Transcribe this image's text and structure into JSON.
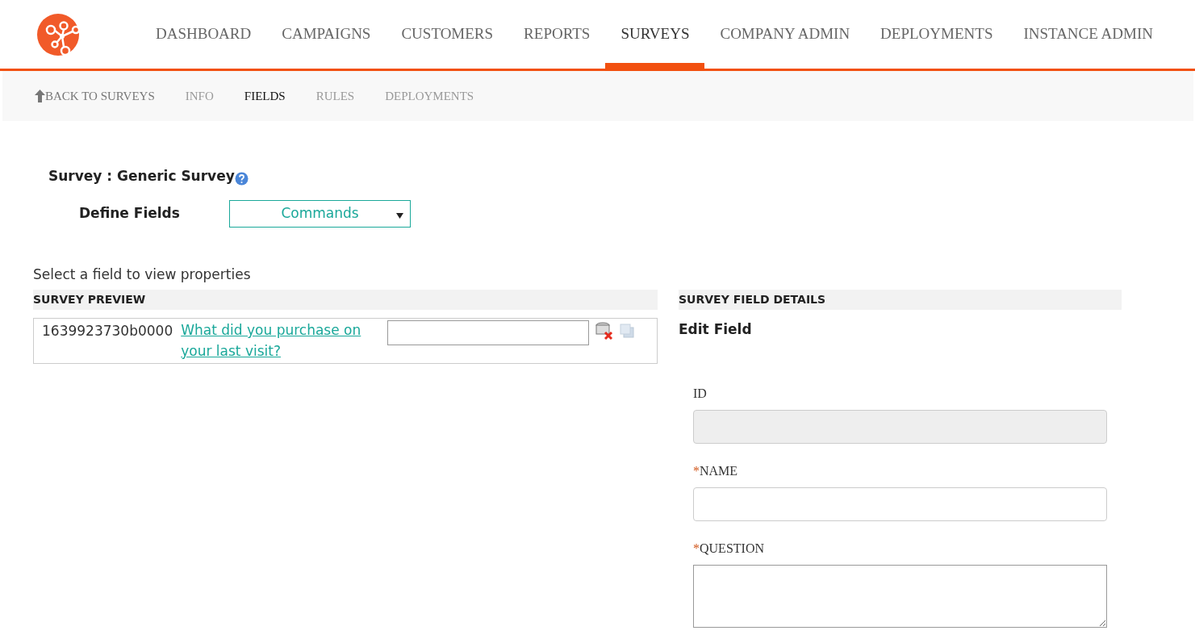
{
  "main_nav": [
    {
      "label": "DASHBOARD",
      "selected": false
    },
    {
      "label": "CAMPAIGNS",
      "selected": false
    },
    {
      "label": "CUSTOMERS",
      "selected": false
    },
    {
      "label": "REPORTS",
      "selected": false
    },
    {
      "label": "SURVEYS",
      "selected": true
    },
    {
      "label": "COMPANY ADMIN",
      "selected": false
    },
    {
      "label": "DEPLOYMENTS",
      "selected": false
    },
    {
      "label": "INSTANCE ADMIN",
      "selected": false
    }
  ],
  "sub_nav": {
    "back": "BACK TO SURVEYS",
    "tabs": [
      {
        "label": "INFO",
        "selected": false
      },
      {
        "label": "FIELDS",
        "selected": true
      },
      {
        "label": "RULES",
        "selected": false
      },
      {
        "label": "DEPLOYMENTS",
        "selected": false
      }
    ]
  },
  "survey_title": "Survey : Generic Survey",
  "define_fields": {
    "label": "Define Fields",
    "commands": "Commands"
  },
  "hint": "Select a field to view properties",
  "preview": {
    "heading": "SURVEY PREVIEW",
    "rows": [
      {
        "id": "1639923730b0000",
        "question": "What did you purchase on your last visit?"
      }
    ]
  },
  "details": {
    "heading": "SURVEY FIELD DETAILS",
    "required_mark": "*",
    "title": "Edit Field",
    "fields": [
      {
        "label": "ID",
        "required": false,
        "kind": "readonly"
      },
      {
        "label": "NAME",
        "required": true,
        "kind": "text"
      },
      {
        "label": "QUESTION",
        "required": true,
        "kind": "textarea"
      }
    ]
  }
}
